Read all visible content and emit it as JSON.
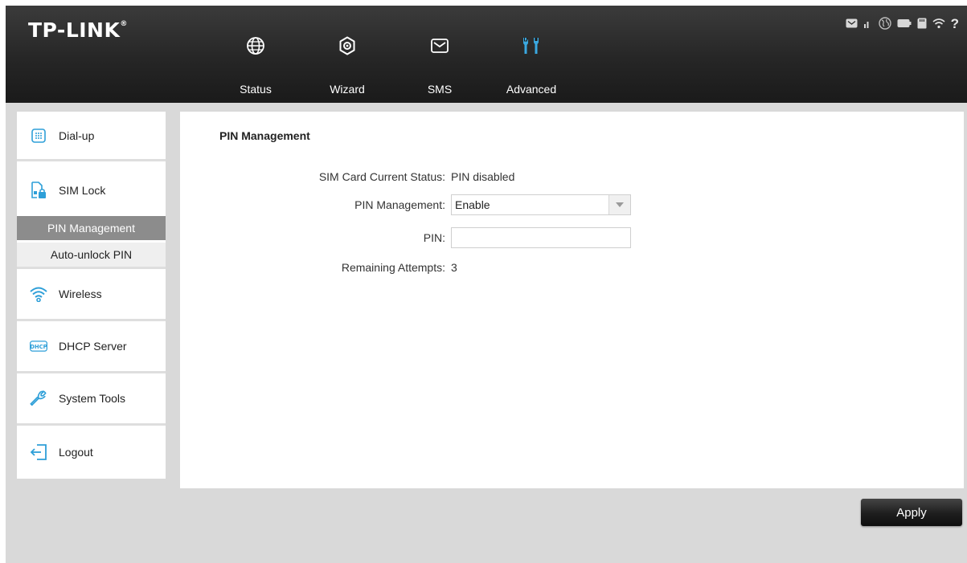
{
  "brand": {
    "logo_text": "TP-LINK",
    "logo_mark": "®"
  },
  "nav": {
    "items": [
      {
        "label": "Status",
        "icon": "globe-icon"
      },
      {
        "label": "Wizard",
        "icon": "wizard-icon"
      },
      {
        "label": "SMS",
        "icon": "envelope-icon"
      },
      {
        "label": "Advanced",
        "icon": "tools-icon",
        "active": true
      }
    ]
  },
  "status_bar": {
    "icons": [
      "sms-status-icon",
      "signal-icon",
      "internet-icon",
      "battery-icon",
      "sd-card-icon",
      "wifi-status-icon",
      "help-icon"
    ],
    "help_text": "?"
  },
  "sidebar": {
    "items": [
      {
        "label": "Dial-up",
        "icon": "dialup-icon"
      },
      {
        "label": "SIM Lock",
        "icon": "sim-lock-icon"
      },
      {
        "label": "Wireless",
        "icon": "wireless-icon"
      },
      {
        "label": "DHCP Server",
        "icon": "dhcp-icon",
        "icon_text": "DHCP"
      },
      {
        "label": "System Tools",
        "icon": "wrench-icon"
      },
      {
        "label": "Logout",
        "icon": "logout-icon"
      }
    ],
    "sim_lock_subitems": [
      {
        "label": "PIN Management",
        "active": true
      },
      {
        "label": "Auto-unlock PIN",
        "active": false
      }
    ]
  },
  "main": {
    "title": "PIN Management",
    "fields": {
      "sim_status_label": "SIM Card Current Status:",
      "sim_status_value": "PIN disabled",
      "pin_mgmt_label": "PIN Management:",
      "pin_mgmt_value": "Enable",
      "pin_label": "PIN:",
      "pin_value": "",
      "attempts_label": "Remaining Attempts:",
      "attempts_value": "3"
    },
    "apply_label": "Apply"
  },
  "colors": {
    "header_bg": "#262626",
    "accent_active_nav": "#2e9fd8",
    "sidebar_active": "#8c8c8c",
    "content_bg": "#d9d9d9"
  }
}
